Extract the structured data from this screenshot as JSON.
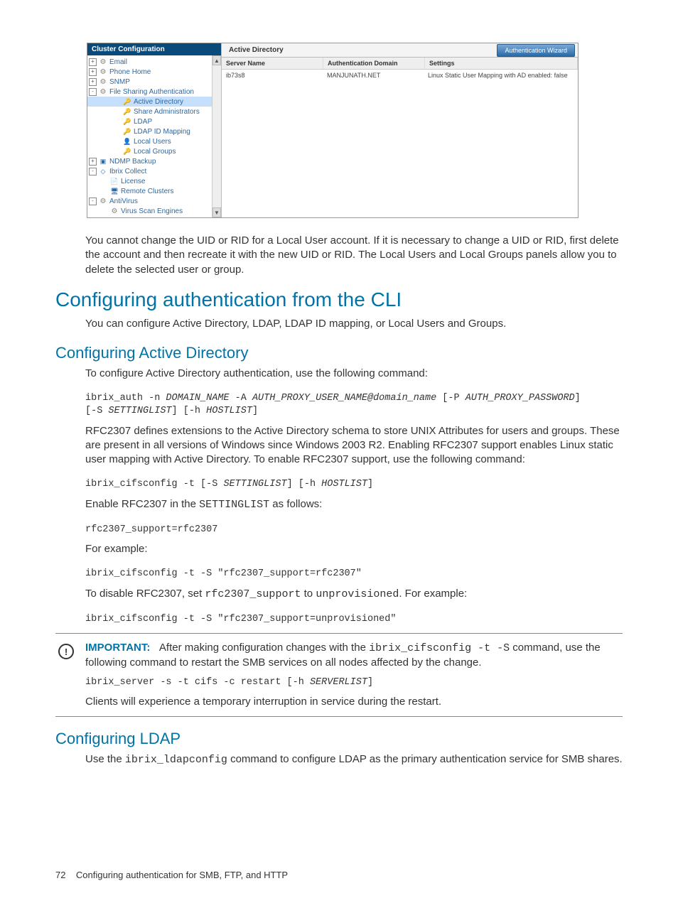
{
  "screenshot": {
    "sidebar_title": "Cluster Configuration",
    "tree": [
      {
        "toggle": "+",
        "icon": "gear",
        "label": "Email",
        "indent": 0
      },
      {
        "toggle": "+",
        "icon": "gear",
        "label": "Phone Home",
        "indent": 0
      },
      {
        "toggle": "+",
        "icon": "gear",
        "label": "SNMP",
        "indent": 0
      },
      {
        "toggle": "-",
        "icon": "gear",
        "label": "File Sharing Authentication",
        "indent": 0
      },
      {
        "toggle": "",
        "icon": "auth",
        "label": "Active Directory",
        "indent": 2,
        "selected": true
      },
      {
        "toggle": "",
        "icon": "auth",
        "label": "Share Administrators",
        "indent": 2
      },
      {
        "toggle": "",
        "icon": "auth",
        "label": "LDAP",
        "indent": 2
      },
      {
        "toggle": "",
        "icon": "auth",
        "label": "LDAP ID Mapping",
        "indent": 2
      },
      {
        "toggle": "",
        "icon": "user",
        "label": "Local Users",
        "indent": 2
      },
      {
        "toggle": "",
        "icon": "auth",
        "label": "Local Groups",
        "indent": 2
      },
      {
        "toggle": "+",
        "icon": "box",
        "label": "NDMP Backup",
        "indent": 0
      },
      {
        "toggle": "-",
        "icon": "col",
        "label": "Ibrix Collect",
        "indent": 0
      },
      {
        "toggle": "",
        "icon": "lic",
        "label": "License",
        "indent": 1
      },
      {
        "toggle": "",
        "icon": "rem",
        "label": "Remote Clusters",
        "indent": 1
      },
      {
        "toggle": "-",
        "icon": "gear",
        "label": "AntiVirus",
        "indent": 0
      },
      {
        "toggle": "",
        "icon": "gear",
        "label": "Virus Scan Engines",
        "indent": 1
      }
    ],
    "tab_label": "Active Directory",
    "wizard_button": "Authentication Wizard",
    "columns": {
      "server": "Server Name",
      "auth": "Authentication Domain",
      "settings": "Settings"
    },
    "row": {
      "server": "ib73s8",
      "auth": "MANJUNATH.NET",
      "settings": "Linux Static User Mapping with AD enabled: false"
    }
  },
  "para_uid": "You cannot change the UID or RID for a Local User account. If it is necessary to change a UID or RID, first delete the account and then recreate it with the new UID or RID. The Local Users and Local Groups panels allow you to delete the selected user or group.",
  "h1": "Configuring authentication from the CLI",
  "h1_intro": "You can configure Active Directory, LDAP, LDAP ID mapping, or Local Users and Groups.",
  "h2_ad": "Configuring Active Directory",
  "ad_intro": "To configure Active Directory authentication, use the following command:",
  "cmd_auth_pre": "ibrix_auth -n ",
  "cmd_auth_dom": "DOMAIN_NAME",
  "cmd_auth_mid1": " -A ",
  "cmd_auth_user": "AUTH_PROXY_USER_NAME@domain_name",
  "cmd_auth_mid2": " [-P ",
  "cmd_auth_pw": "AUTH_PROXY_PASSWORD",
  "cmd_auth_end1": "]",
  "cmd_auth_line2a": "[-S ",
  "cmd_auth_set": "SETTINGLIST",
  "cmd_auth_line2b": "] [-h ",
  "cmd_auth_host": "HOSTLIST",
  "cmd_auth_line2c": "]",
  "rfc_para": "RFC2307 defines extensions to the Active Directory schema to store UNIX Attributes for users and groups. These are present in all versions of Windows since Windows 2003 R2. Enabling RFC2307 support enables Linux static user mapping with Active Directory. To enable RFC2307 support, use the following command:",
  "cmd_cifs1_a": "ibrix_cifsconfig -t [-S ",
  "cmd_cifs1_b": "SETTINGLIST",
  "cmd_cifs1_c": "] [-h ",
  "cmd_cifs1_d": "HOSTLIST",
  "cmd_cifs1_e": "]",
  "enable_line_a": "Enable RFC2307 in the ",
  "enable_line_b": "SETTINGLIST",
  "enable_line_c": " as follows:",
  "cmd_rfc": "rfc2307_support=rfc2307",
  "for_example": "For example:",
  "cmd_ex1": "ibrix_cifsconfig -t -S \"rfc2307_support=rfc2307\"",
  "disable_a": "To disable RFC2307, set ",
  "disable_b": "rfc2307_support",
  "disable_c": " to ",
  "disable_d": "unprovisioned",
  "disable_e": ". For example:",
  "cmd_ex2": "ibrix_cifsconfig -t -S \"rfc2307_support=unprovisioned\"",
  "imp_label": "IMPORTANT:",
  "imp_a": "After making configuration changes with the ",
  "imp_b": "ibrix_cifsconfig -t -S",
  "imp_c": " command, use the following command to restart the SMB services on all nodes affected by the change.",
  "cmd_restart_a": "ibrix_server -s -t cifs -c restart [-h ",
  "cmd_restart_b": "SERVERLIST",
  "cmd_restart_c": "]",
  "imp_tail": "Clients will experience a temporary interruption in service during the restart.",
  "h2_ldap": "Configuring LDAP",
  "ldap_a": "Use the ",
  "ldap_b": "ibrix_ldapconfig",
  "ldap_c": " command to configure LDAP as the primary authentication service for SMB shares.",
  "footer_num": "72",
  "footer_txt": "Configuring authentication for SMB, FTP, and HTTP"
}
